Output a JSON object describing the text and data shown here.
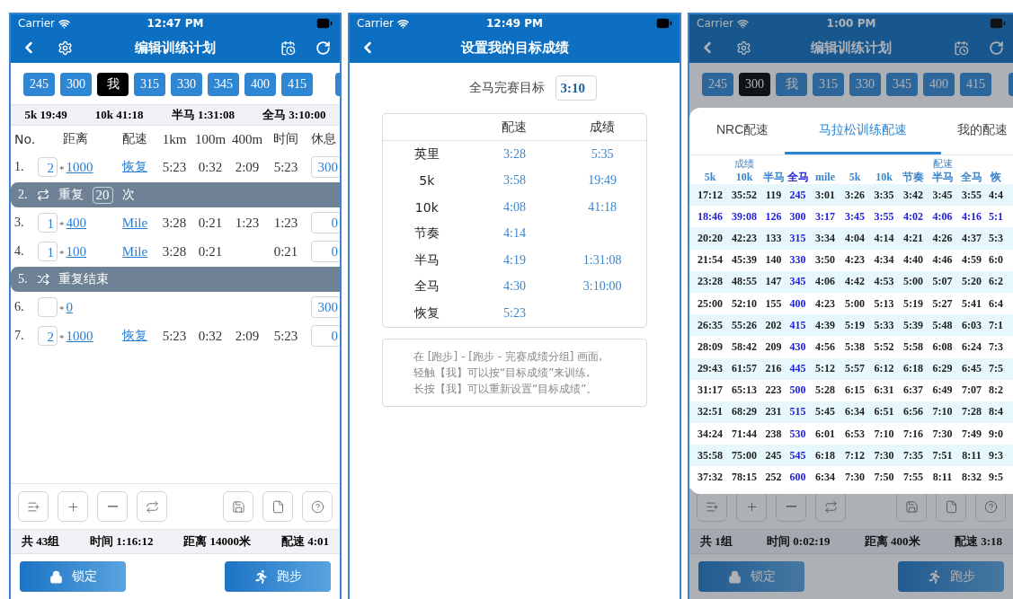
{
  "editor_screen": {
    "status": {
      "carrier": "Carrier",
      "time": "12:47 PM"
    },
    "title": "编辑训练计划",
    "presets": [
      {
        "label": "245",
        "selected": false
      },
      {
        "label": "300",
        "selected": false
      },
      {
        "label": "我",
        "selected": true
      },
      {
        "label": "315",
        "selected": false
      },
      {
        "label": "330",
        "selected": false
      },
      {
        "label": "345",
        "selected": false
      },
      {
        "label": "400",
        "selected": false
      },
      {
        "label": "415",
        "selected": false
      }
    ],
    "summary": [
      "5k 19:49",
      "10k 41:18",
      "半马 1:31:08",
      "全马 3:10:00"
    ],
    "columns": [
      "No.",
      "距离",
      "配速",
      "1km",
      "100m",
      "400m",
      "时间",
      "休息"
    ],
    "rows": [
      {
        "kind": "step",
        "no": "1.",
        "count": "2",
        "multiplier": "*",
        "distance": "1000",
        "pace": "恢复",
        "km": "5:23",
        "m100": "0:32",
        "m400": "2:09",
        "time": "5:23",
        "rest": "300"
      },
      {
        "kind": "repeat_start",
        "no": "2.",
        "label": "重复",
        "count": "20",
        "unit": "次"
      },
      {
        "kind": "step",
        "no": "3.",
        "count": "1",
        "multiplier": "*",
        "distance": "400",
        "pace": "Mile",
        "km": "3:28",
        "m100": "0:21",
        "m400": "1:23",
        "time": "1:23",
        "rest": "0"
      },
      {
        "kind": "step",
        "no": "4.",
        "count": "1",
        "multiplier": "*",
        "distance": "100",
        "pace": "Mile",
        "km": "3:28",
        "m100": "0:21",
        "time": "0:21",
        "rest": "0"
      },
      {
        "kind": "repeat_end",
        "no": "5.",
        "label": "重复结束"
      },
      {
        "kind": "step",
        "no": "6.",
        "multiplier": "*",
        "distance": "0",
        "rest": "300"
      },
      {
        "kind": "step",
        "no": "7.",
        "count": "2",
        "multiplier": "*",
        "distance": "1000",
        "pace": "恢复",
        "km": "5:23",
        "m100": "0:32",
        "m400": "2:09",
        "time": "5:23",
        "rest": "0"
      }
    ],
    "totals": [
      "共 43组",
      "时间 1:16:12",
      "距离 14000米",
      "配速 4:01"
    ],
    "actions": [
      {
        "kind": "lock",
        "label": "锁定"
      },
      {
        "kind": "run",
        "label": "跑步"
      }
    ]
  },
  "target_screen": {
    "status": {
      "carrier": "Carrier",
      "time": "12:49 PM"
    },
    "title": "设置我的目标成绩",
    "goal": {
      "label": "全马完赛目标",
      "value": "3:10"
    },
    "columns": [
      "配速",
      "成绩"
    ],
    "rows": [
      {
        "label": "英里",
        "pace": "3:28",
        "result": "5:35"
      },
      {
        "label": "5k",
        "pace": "3:58",
        "result": "19:49"
      },
      {
        "label": "10k",
        "pace": "4:08",
        "result": "41:18"
      },
      {
        "label": "节奏",
        "pace": "4:14"
      },
      {
        "label": "半马",
        "pace": "4:19",
        "result": "1:31:08"
      },
      {
        "label": "全马",
        "pace": "4:30",
        "result": "3:10:00"
      },
      {
        "label": "恢复",
        "pace": "5:23"
      }
    ],
    "note_lines": [
      "在 [跑步] - [跑步 - 完赛成绩分组] 画面,",
      "轻触【我】可以按“目标成绩”来训练,",
      "长按【我】可以重新设置“目标成绩”。"
    ]
  },
  "pace_screen": {
    "status": {
      "carrier": "Carrier",
      "time": "1:00 PM"
    },
    "title": "编辑训练计划",
    "presets": [
      {
        "label": "245",
        "selected": false
      },
      {
        "label": "300",
        "selected": true
      },
      {
        "label": "我",
        "selected": false
      },
      {
        "label": "315",
        "selected": false
      },
      {
        "label": "330",
        "selected": false
      },
      {
        "label": "345",
        "selected": false
      },
      {
        "label": "400",
        "selected": false
      },
      {
        "label": "415",
        "selected": false
      }
    ],
    "sheet": {
      "tabs": [
        {
          "label": "NRC配速",
          "selected": false
        },
        {
          "label": "马拉松训练配速",
          "selected": true
        },
        {
          "label": "我的配速",
          "selected": false
        }
      ],
      "groups": [
        {
          "label": "成绩",
          "columns": [
            {
              "label": "5k",
              "highlighted": false
            },
            {
              "label": "10k",
              "highlighted": false
            },
            {
              "label": "半马",
              "highlighted": false
            },
            {
              "label": "全马",
              "highlighted": true
            }
          ]
        },
        {
          "label": "配速",
          "columns": [
            {
              "label": "mile",
              "highlighted": false
            },
            {
              "label": "5k",
              "highlighted": false
            },
            {
              "label": "10k",
              "highlighted": false
            },
            {
              "label": "节奏",
              "highlighted": false
            },
            {
              "label": "半马",
              "highlighted": false
            },
            {
              "label": "全马",
              "highlighted": false
            },
            {
              "label": "恢",
              "highlighted": false
            }
          ]
        }
      ],
      "rows": [
        {
          "selected": false,
          "cells": [
            "17:12",
            "35:52",
            "119",
            "245",
            "3:01",
            "3:26",
            "3:35",
            "3:42",
            "3:45",
            "3:55",
            "4:4"
          ]
        },
        {
          "selected": true,
          "cells": [
            "18:46",
            "39:08",
            "126",
            "300",
            "3:17",
            "3:45",
            "3:55",
            "4:02",
            "4:06",
            "4:16",
            "5:1"
          ]
        },
        {
          "selected": false,
          "cells": [
            "20:20",
            "42:23",
            "133",
            "315",
            "3:34",
            "4:04",
            "4:14",
            "4:21",
            "4:26",
            "4:37",
            "5:3"
          ]
        },
        {
          "selected": false,
          "cells": [
            "21:54",
            "45:39",
            "140",
            "330",
            "3:50",
            "4:23",
            "4:34",
            "4:40",
            "4:46",
            "4:59",
            "6:0"
          ]
        },
        {
          "selected": false,
          "cells": [
            "23:28",
            "48:55",
            "147",
            "345",
            "4:06",
            "4:42",
            "4:53",
            "5:00",
            "5:07",
            "5:20",
            "6:2"
          ]
        },
        {
          "selected": false,
          "cells": [
            "25:00",
            "52:10",
            "155",
            "400",
            "4:23",
            "5:00",
            "5:13",
            "5:19",
            "5:27",
            "5:41",
            "6:4"
          ]
        },
        {
          "selected": false,
          "cells": [
            "26:35",
            "55:26",
            "202",
            "415",
            "4:39",
            "5:19",
            "5:33",
            "5:39",
            "5:48",
            "6:03",
            "7:1"
          ]
        },
        {
          "selected": false,
          "cells": [
            "28:09",
            "58:42",
            "209",
            "430",
            "4:56",
            "5:38",
            "5:52",
            "5:58",
            "6:08",
            "6:24",
            "7:3"
          ]
        },
        {
          "selected": false,
          "cells": [
            "29:43",
            "61:57",
            "216",
            "445",
            "5:12",
            "5:57",
            "6:12",
            "6:18",
            "6:29",
            "6:45",
            "7:5"
          ]
        },
        {
          "selected": false,
          "cells": [
            "31:17",
            "65:13",
            "223",
            "500",
            "5:28",
            "6:15",
            "6:31",
            "6:37",
            "6:49",
            "7:07",
            "8:2"
          ]
        },
        {
          "selected": false,
          "cells": [
            "32:51",
            "68:29",
            "231",
            "515",
            "5:45",
            "6:34",
            "6:51",
            "6:56",
            "7:10",
            "7:28",
            "8:4"
          ]
        },
        {
          "selected": false,
          "cells": [
            "34:24",
            "71:44",
            "238",
            "530",
            "6:01",
            "6:53",
            "7:10",
            "7:16",
            "7:30",
            "7:49",
            "9:0"
          ]
        },
        {
          "selected": false,
          "cells": [
            "35:58",
            "75:00",
            "245",
            "545",
            "6:18",
            "7:12",
            "7:30",
            "7:35",
            "7:51",
            "8:11",
            "9:3"
          ]
        },
        {
          "selected": false,
          "cells": [
            "37:32",
            "78:15",
            "252",
            "600",
            "6:34",
            "7:30",
            "7:50",
            "7:55",
            "8:11",
            "8:32",
            "9:5"
          ]
        }
      ]
    },
    "totals": [
      "共 1组",
      "时间 0:02:19",
      "距离 400米",
      "配速 3:18"
    ],
    "actions": [
      {
        "kind": "lock",
        "label": "锁定"
      },
      {
        "kind": "run",
        "label": "跑步"
      }
    ]
  }
}
